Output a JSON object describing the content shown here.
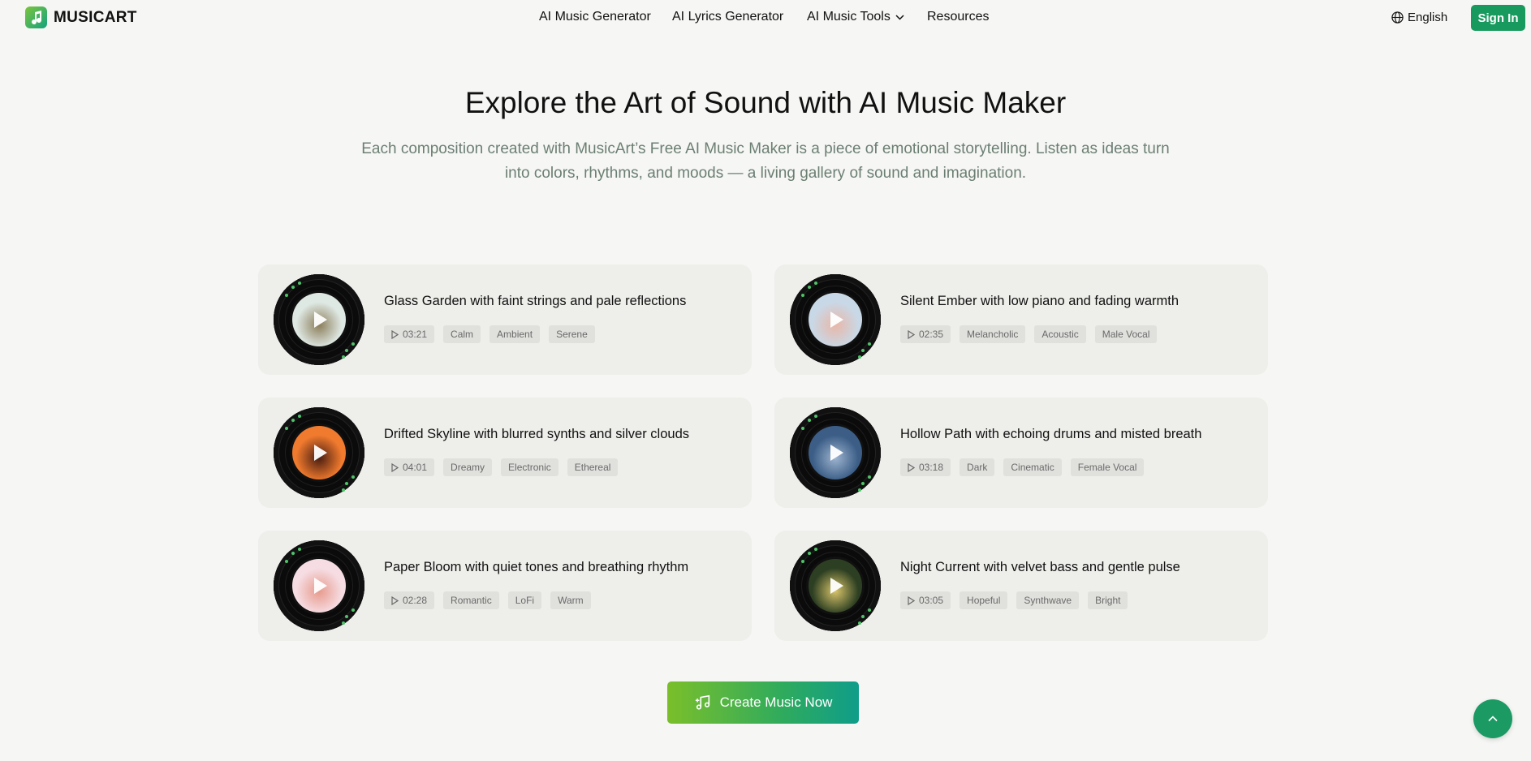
{
  "brand": {
    "name": "MUSICART"
  },
  "nav": {
    "items": [
      {
        "label": "AI Music Generator"
      },
      {
        "label": "AI Lyrics Generator"
      },
      {
        "label": "AI Music Tools",
        "has_dropdown": true
      },
      {
        "label": "Resources"
      }
    ],
    "language": "English",
    "signin": "Sign In"
  },
  "hero": {
    "title": "Explore the Art of Sound with AI Music Maker",
    "subtitle": "Each composition created with MusicArt’s Free AI Music Maker is a piece of emotional storytelling. Listen as ideas turn into colors, rhythms, and moods — a living gallery of sound and imagination."
  },
  "tracks": [
    {
      "title": "Glass Garden with faint strings and pale reflections",
      "duration": "03:21",
      "tags": [
        "Calm",
        "Ambient",
        "Serene"
      ],
      "art_color": "#dfe9e4",
      "art_accent": "#8b7d5a"
    },
    {
      "title": "Silent Ember with low piano and fading warmth",
      "duration": "02:35",
      "tags": [
        "Melancholic",
        "Acoustic",
        "Male Vocal"
      ],
      "art_color": "#c9d8e6",
      "art_accent": "#e8b7a8"
    },
    {
      "title": "Drifted Skyline with blurred synths and silver clouds",
      "duration": "04:01",
      "tags": [
        "Dreamy",
        "Electronic",
        "Ethereal"
      ],
      "art_color": "#f07a2e",
      "art_accent": "#4a1d10"
    },
    {
      "title": "Hollow Path with echoing drums and misted breath",
      "duration": "03:18",
      "tags": [
        "Dark",
        "Cinematic",
        "Female Vocal"
      ],
      "art_color": "#3b5d86",
      "art_accent": "#9db4cf"
    },
    {
      "title": "Paper Bloom with quiet tones and breathing rhythm",
      "duration": "02:28",
      "tags": [
        "Romantic",
        "LoFi",
        "Warm"
      ],
      "art_color": "#f6dde3",
      "art_accent": "#e79a8c"
    },
    {
      "title": "Night Current with velvet bass and gentle pulse",
      "duration": "03:05",
      "tags": [
        "Hopeful",
        "Synthwave",
        "Bright"
      ],
      "art_color": "#2d3f22",
      "art_accent": "#d8c46a"
    }
  ],
  "cta": {
    "label": "Create Music Now"
  },
  "colors": {
    "brand": "#189a5e",
    "subtitle": "#6b7f73",
    "card_bg": "#eeeeeb"
  }
}
